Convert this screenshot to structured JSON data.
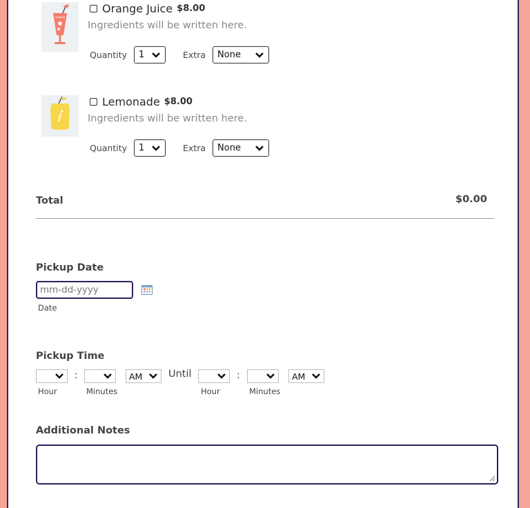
{
  "products": [
    {
      "name": "Orange Juice",
      "price": "$8.00",
      "description": "Ingredients will be written here.",
      "quantity_label": "Quantity",
      "quantity_value": "1",
      "extra_label": "Extra",
      "extra_value": "None",
      "icon": "orange-juice-icon",
      "icon_color": "#f47d6a"
    },
    {
      "name": "Lemonade",
      "price": "$8.00",
      "description": "Ingredients will be written here.",
      "quantity_label": "Quantity",
      "quantity_value": "1",
      "extra_label": "Extra",
      "extra_value": "None",
      "icon": "lemonade-icon",
      "icon_color": "#f7d64c"
    }
  ],
  "total": {
    "label": "Total",
    "value": "$0.00"
  },
  "pickup_date": {
    "label": "Pickup Date",
    "placeholder": "mm-dd-yyyy",
    "sublabel": "Date"
  },
  "pickup_time": {
    "label": "Pickup Time",
    "from": {
      "hour_label": "Hour",
      "minutes_label": "Minutes",
      "ampm": "AM",
      "colon": ":"
    },
    "until_label": "Until",
    "to": {
      "hour_label": "Hour",
      "minutes_label": "Minutes",
      "ampm": "AM",
      "colon": ":"
    }
  },
  "notes": {
    "label": "Additional Notes"
  },
  "colors": {
    "page_background": "#f3a596",
    "accent_border": "#2b2160"
  }
}
